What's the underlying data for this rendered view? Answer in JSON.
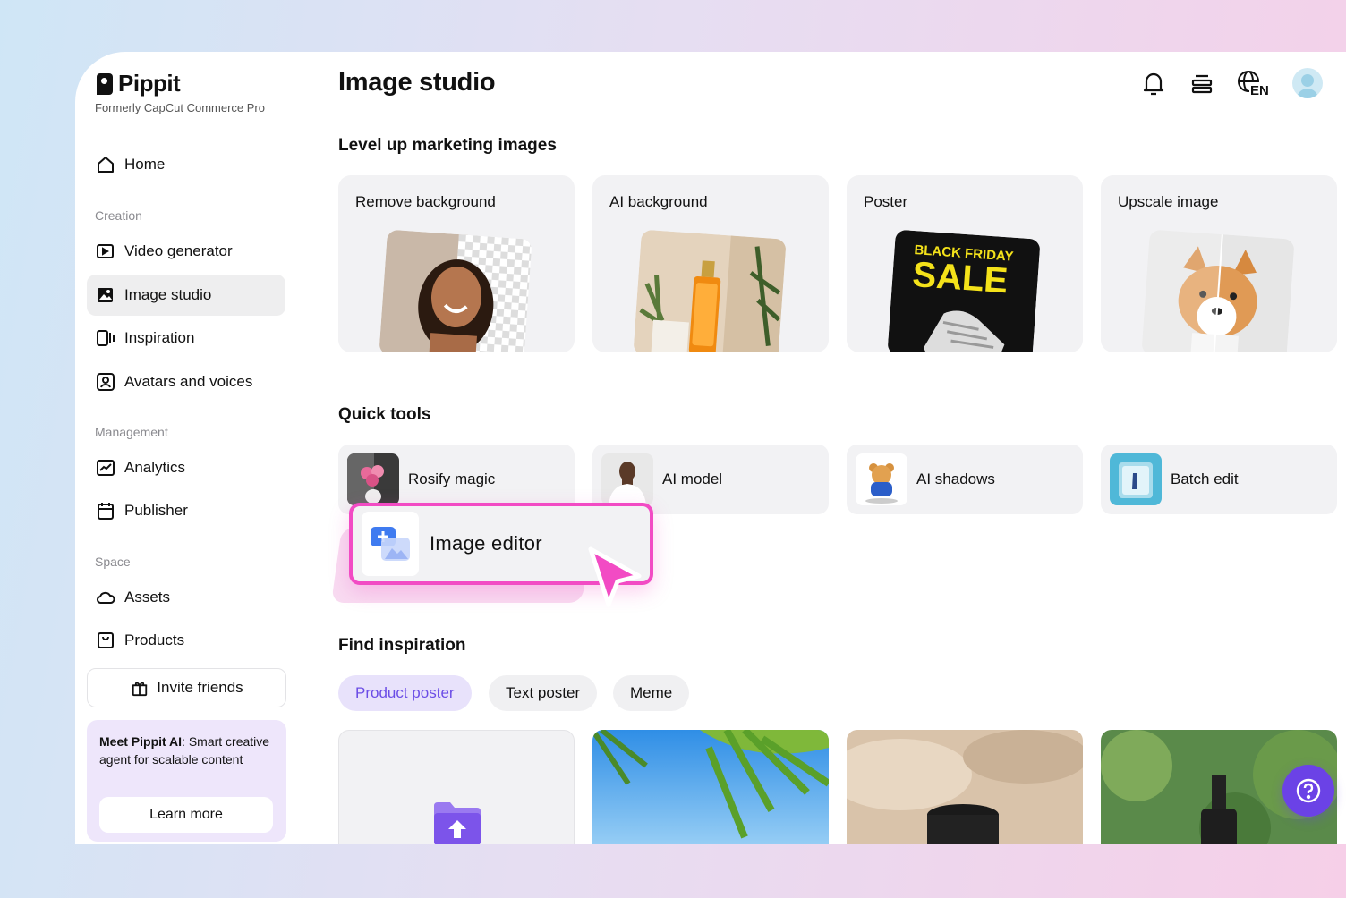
{
  "brand": {
    "name": "Pippit",
    "subtitle": "Formerly CapCut Commerce Pro"
  },
  "sidebar": {
    "home": "Home",
    "sections": [
      {
        "label": "Creation",
        "items": [
          {
            "label": "Video generator",
            "icon": "video-generator-icon"
          },
          {
            "label": "Image studio",
            "icon": "image-studio-icon",
            "active": true
          },
          {
            "label": "Inspiration",
            "icon": "inspiration-icon"
          },
          {
            "label": "Avatars and voices",
            "icon": "avatar-icon"
          }
        ]
      },
      {
        "label": "Management",
        "items": [
          {
            "label": "Analytics",
            "icon": "analytics-icon"
          },
          {
            "label": "Publisher",
            "icon": "calendar-icon"
          }
        ]
      },
      {
        "label": "Space",
        "items": [
          {
            "label": "Assets",
            "icon": "cloud-icon"
          },
          {
            "label": "Products",
            "icon": "product-box-icon"
          }
        ]
      }
    ],
    "invite": "Invite friends",
    "promo": {
      "bold": "Meet Pippit AI",
      "text": ": Smart creative agent for scalable content",
      "button": "Learn more"
    }
  },
  "header": {
    "title": "Image studio",
    "language": "EN"
  },
  "marketing": {
    "heading": "Level up marketing images",
    "cards": [
      "Remove background",
      "AI background",
      "Poster",
      "Upscale image"
    ],
    "poster_text": {
      "line1": "BLACK FRIDAY",
      "line2": "SALE"
    }
  },
  "quick_tools": {
    "heading": "Quick tools",
    "items": [
      "Rosify magic",
      "AI model",
      "AI shadows",
      "Batch edit"
    ],
    "popup": "Image editor"
  },
  "inspiration": {
    "heading": "Find inspiration",
    "chips": [
      "Product poster",
      "Text poster",
      "Meme"
    ]
  },
  "colors": {
    "accent": "#6b42e6",
    "highlight": "#f24bc4",
    "chip_active_bg": "#e8e2fb"
  }
}
